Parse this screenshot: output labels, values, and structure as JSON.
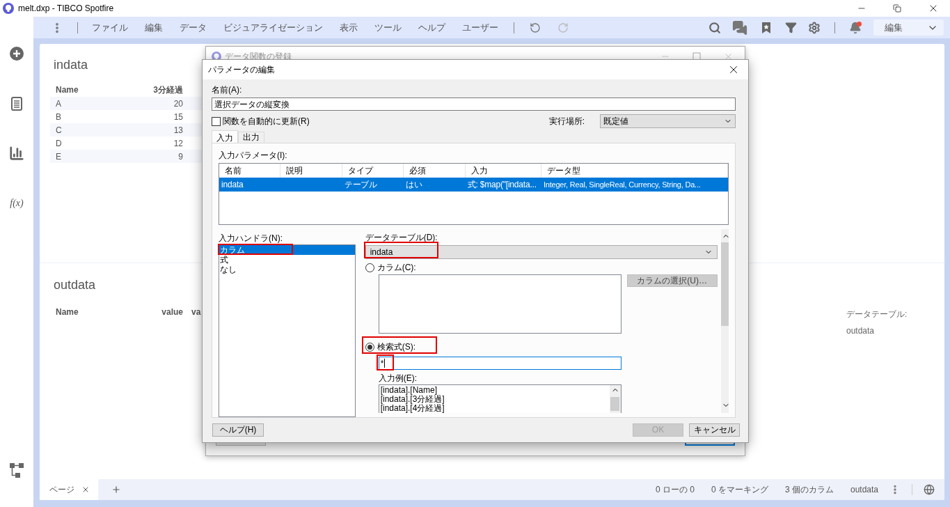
{
  "window": {
    "title": "melt.dxp - TIBCO Spotfire"
  },
  "menu_bar": {
    "items": [
      "ファイル",
      "編集",
      "データ",
      "ビジュアライゼーション",
      "表示",
      "ツール",
      "ヘルプ",
      "ユーザー"
    ],
    "mode": "編集"
  },
  "sidebar": {
    "function_label": "f(x)"
  },
  "visualizations": [
    {
      "title": "indata",
      "columns": [
        "Name",
        "3分経過"
      ],
      "rows": [
        [
          "A",
          "20"
        ],
        [
          "B",
          "15"
        ],
        [
          "C",
          "13"
        ],
        [
          "D",
          "12"
        ],
        [
          "E",
          "9"
        ]
      ]
    },
    {
      "title": "outdata",
      "columns": [
        "Name",
        "value",
        "va"
      ]
    }
  ],
  "details": {
    "label": "データテーブル:",
    "value": "outdata"
  },
  "page_tabs": [
    {
      "label": "ページ",
      "selected": true
    }
  ],
  "status_bar": [
    "0 ローの 0",
    "0 をマーキング",
    "3 個のカラム",
    "outdata"
  ],
  "back_dialog": {
    "title": "データ関数の登録"
  },
  "dialog": {
    "title": "パラメータの編集",
    "name_label": "名前(A):",
    "name_value": "選択データの縦変換",
    "auto_update": {
      "label": "関数を自動的に更新(R)",
      "checked": false
    },
    "location_label": "実行場所:",
    "location_value": "既定値",
    "tabs": [
      {
        "label": "入力",
        "selected": true
      },
      {
        "label": "出力",
        "selected": false
      }
    ],
    "params_label": "入力パラメータ(I):",
    "params_columns": [
      "名前",
      "説明",
      "タイプ",
      "必須",
      "入力",
      "データ型"
    ],
    "params_rows": [
      {
        "cells": [
          "indata",
          "",
          "テーブル",
          "はい",
          "式: $map(\"[indata...",
          "Integer, Real, SingleReal, Currency, String, Da..."
        ],
        "selected": true
      }
    ],
    "handler_label": "入力ハンドラ(N):",
    "handlers": [
      {
        "label": "カラム",
        "selected": true
      },
      {
        "label": "式",
        "selected": false
      },
      {
        "label": "なし",
        "selected": false
      }
    ],
    "table_label": "データテーブル(D):",
    "table_value": "indata",
    "column_radio": {
      "label": "カラム(C):",
      "selected": false
    },
    "column_button": "カラムの選択(U)…",
    "expr_radio": {
      "label": "検索式(S):",
      "selected": true
    },
    "expr_value": "*",
    "example_label": "入力例(E):",
    "examples": [
      "[indata].[Name]",
      "[indata].[3分経過]",
      "[indata].[4分経過]"
    ],
    "help_button": "ヘルプ(H)",
    "ok_button": {
      "label": "OK",
      "disabled": true
    },
    "cancel_button": "キャンセル"
  }
}
